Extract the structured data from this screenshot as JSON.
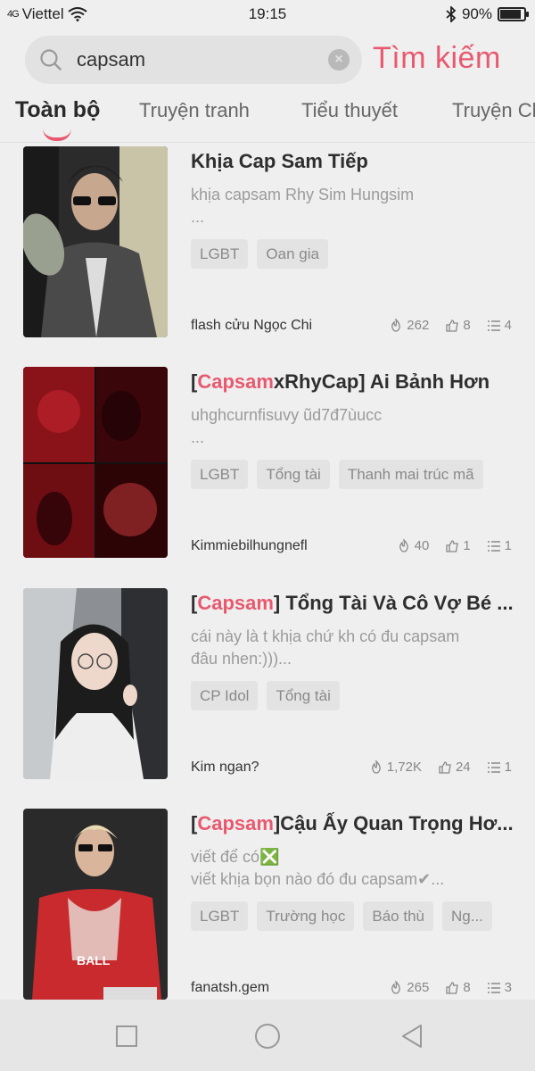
{
  "status_bar": {
    "signal": "4G",
    "carrier": "Viettel",
    "time": "19:15",
    "battery": "90%",
    "battery_level": 0.9
  },
  "search": {
    "query": "capsam",
    "submit_label": "Tìm kiếm"
  },
  "tabs": [
    {
      "label": "Toàn bộ"
    },
    {
      "label": "Truyện tranh"
    },
    {
      "label": "Tiểu thuyết"
    },
    {
      "label": "Truyện Ch"
    }
  ],
  "results": [
    {
      "title_prefix": "",
      "title_highlight": "",
      "title_rest": "Khịa Cap Sam Tiếp",
      "desc_line1": "khịa capsam Rhy Sim Hungsim",
      "desc_line2": "...",
      "tags": [
        "LGBT",
        "Oan gia"
      ],
      "author": "flash cửu Ngọc Chi",
      "views": "262",
      "likes": "8",
      "chapters": "4"
    },
    {
      "title_prefix": "[",
      "title_highlight": "Capsam",
      "title_rest": "xRhyCap] Ai Bảnh Hơn",
      "desc_line1": "uhghcurnfisuvy ũd7đ7ùucc",
      "desc_line2": "...",
      "tags": [
        "LGBT",
        "Tổng tài",
        "Thanh mai trúc mã"
      ],
      "author": "Kimmiebilhungnefl",
      "views": "40",
      "likes": "1",
      "chapters": "1"
    },
    {
      "title_prefix": "[",
      "title_highlight": "Capsam",
      "title_rest": "] Tổng Tài Và Cô Vợ Bé ...",
      "desc_line1": "cái này là t khịa chứ kh có đu capsam",
      "desc_line2": "đâu nhen:)))...",
      "tags": [
        "CP Idol",
        "Tổng tài"
      ],
      "author": "Kim ngan?",
      "views": "1,72K",
      "likes": "24",
      "chapters": "1"
    },
    {
      "title_prefix": "[",
      "title_highlight": "Capsam",
      "title_rest": "]Cậu Ấy Quan Trọng Hơ...",
      "desc_line1": "viết để có❎",
      "desc_line2": "viết khịa bọn nào đó đu capsam✔...",
      "tags": [
        "LGBT",
        "Trường học",
        "Báo thù",
        "Ng..."
      ],
      "author": "fanatsh.gem",
      "views": "265",
      "likes": "8",
      "chapters": "3"
    }
  ],
  "colors": {
    "accent": "#e8596f",
    "background": "#efefef"
  }
}
